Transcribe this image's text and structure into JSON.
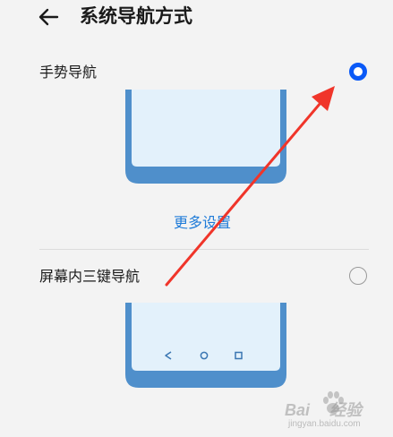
{
  "header": {
    "title": "系统导航方式",
    "back_icon": "arrow-left-icon"
  },
  "options": [
    {
      "label": "手势导航",
      "selected": true
    },
    {
      "label": "屏幕内三键导航",
      "selected": false
    }
  ],
  "more_settings_label": "更多设置",
  "colors": {
    "accent": "#0a59f7",
    "link": "#1f7bd8",
    "phone_frame": "#4f8fcb",
    "phone_screen": "#e3f1fb",
    "annotation_arrow": "#f0352a",
    "background": "#f3f3f3"
  },
  "nav_bar_icons": [
    "back-triangle-icon",
    "home-circle-icon",
    "recents-square-icon"
  ],
  "watermark": {
    "brand": "Baidu",
    "sub": "jingyan.baidu.com"
  }
}
